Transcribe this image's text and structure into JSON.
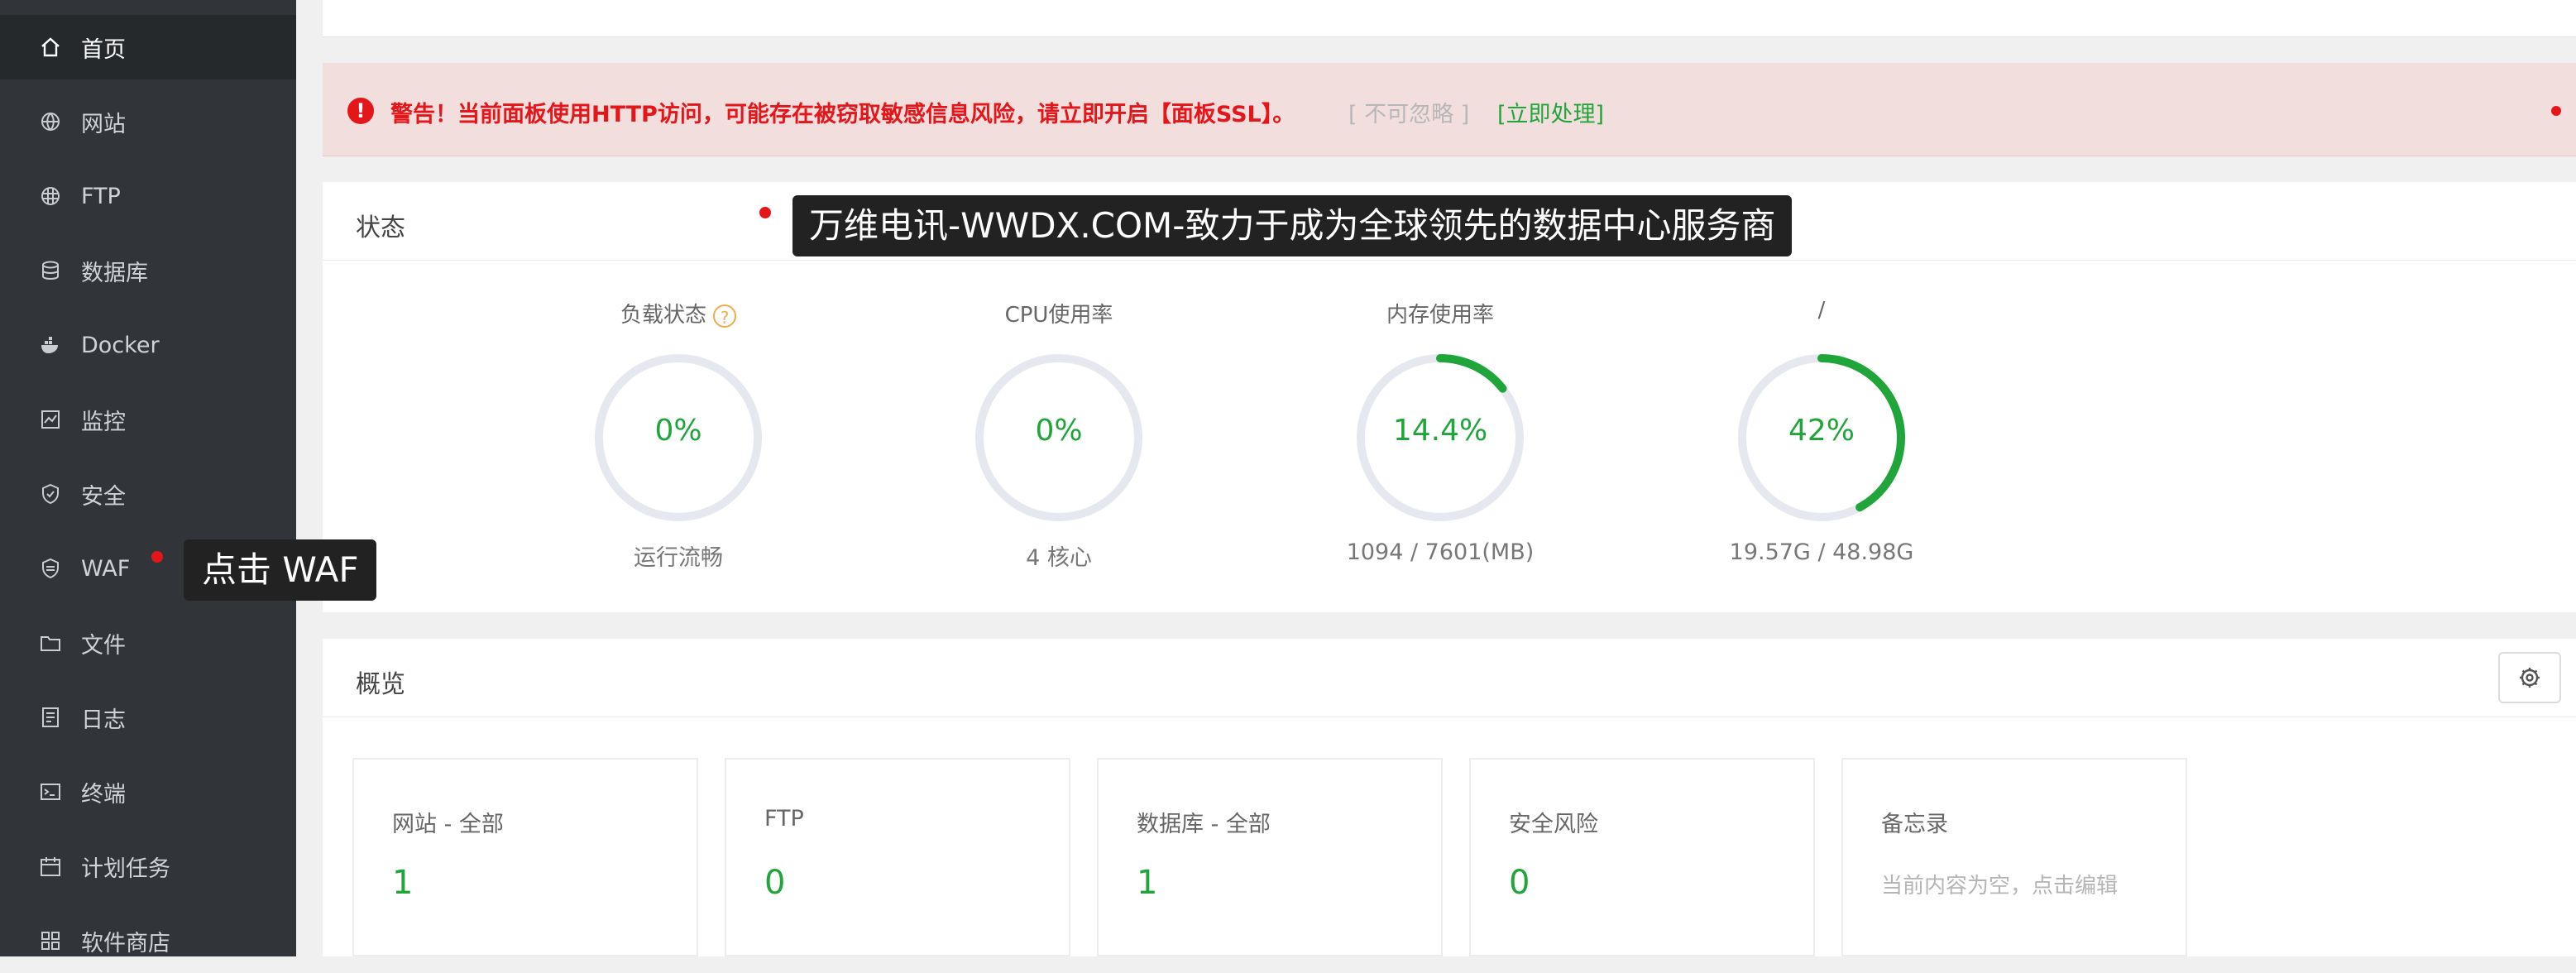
{
  "sidebar": {
    "items": [
      {
        "label": "首页",
        "icon": "home-icon",
        "active": true
      },
      {
        "label": "网站",
        "icon": "globe-icon"
      },
      {
        "label": "FTP",
        "icon": "ftp-globe-icon"
      },
      {
        "label": "数据库",
        "icon": "database-icon"
      },
      {
        "label": "Docker",
        "icon": "docker-icon"
      },
      {
        "label": "监控",
        "icon": "monitor-icon"
      },
      {
        "label": "安全",
        "icon": "shield-icon"
      },
      {
        "label": "WAF",
        "icon": "waf-shield-icon"
      },
      {
        "label": "文件",
        "icon": "folder-icon"
      },
      {
        "label": "日志",
        "icon": "log-icon"
      },
      {
        "label": "终端",
        "icon": "terminal-icon"
      },
      {
        "label": "计划任务",
        "icon": "calendar-icon"
      },
      {
        "label": "软件商店",
        "icon": "apps-grid-icon"
      }
    ]
  },
  "alert": {
    "warning_text": "警告！当前面板使用HTTP访问，可能存在被窃取敏感信息风险，请立即开启【面板SSL】。",
    "ignore_text": "[ 不可忽略 ]",
    "handle_text": "[立即处理]"
  },
  "status": {
    "title": "状态",
    "gauges": [
      {
        "title": "负载状态",
        "value": "0%",
        "percent": 0,
        "sub": "运行流畅",
        "help": "?"
      },
      {
        "title": "CPU使用率",
        "value": "0%",
        "percent": 0,
        "sub": "4 核心"
      },
      {
        "title": "内存使用率",
        "value": "14.4%",
        "percent": 14.4,
        "sub": "1094 / 7601(MB)"
      },
      {
        "title": "/",
        "value": "42%",
        "percent": 42,
        "sub": "19.57G / 48.98G"
      }
    ]
  },
  "overview": {
    "title": "概览",
    "cards": [
      {
        "title": "网站 - 全部",
        "value": "1"
      },
      {
        "title": "FTP",
        "value": "0"
      },
      {
        "title": "数据库 - 全部",
        "value": "1"
      },
      {
        "title": "安全风险",
        "value": "0"
      },
      {
        "title": "备忘录",
        "note": "当前内容为空，点击编辑"
      }
    ]
  },
  "tooltips": {
    "banner": "万维电讯-WWDX.COM-致力于成为全球领先的数据中心服务商",
    "waf_hint": "点击 WAF"
  },
  "colors": {
    "sidebar_bg": "#313539",
    "accent_green": "#20a53a",
    "warning_red": "#e5161a",
    "alert_bg": "#f3dede",
    "gauge_track": "#e5e8ee"
  }
}
